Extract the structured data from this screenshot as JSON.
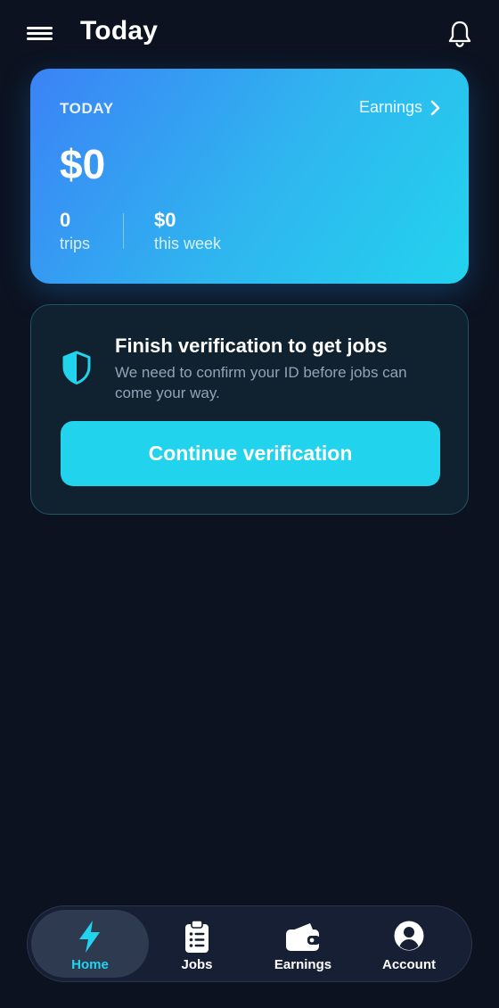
{
  "header": {
    "title": "Today"
  },
  "today_card": {
    "label": "TODAY",
    "earnings_link": "Earnings",
    "amount": "$0",
    "trips_value": "0",
    "trips_label": "trips",
    "week_value": "$0",
    "week_label": "this week"
  },
  "verification": {
    "title": "Finish verification to get jobs",
    "description": "We need to confirm your ID before jobs can come your way.",
    "button_label": "Continue verification"
  },
  "bottom_nav": {
    "items": [
      {
        "label": "Home",
        "icon": "lightning-icon",
        "active": true
      },
      {
        "label": "Jobs",
        "icon": "clipboard-icon",
        "active": false
      },
      {
        "label": "Earnings",
        "icon": "wallet-icon",
        "active": false
      },
      {
        "label": "Account",
        "icon": "user-circle-icon",
        "active": false
      }
    ]
  },
  "colors": {
    "background": "#0c1220",
    "accent": "#22d3ee",
    "gradient_start": "#3b82f6",
    "gradient_end": "#22d3ee",
    "muted_text": "#94a3b8"
  }
}
